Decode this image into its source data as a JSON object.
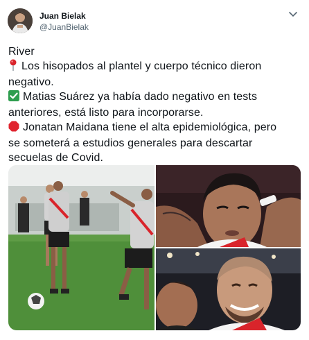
{
  "author": {
    "name": "Juan Bielak",
    "handle": "@JuanBielak"
  },
  "tweet": {
    "lines": [
      {
        "emoji": "",
        "text": "River"
      },
      {
        "emoji": "round-pushpin-icon",
        "text": "Los hisopados al plantel y cuerpo técnico dieron"
      },
      {
        "emoji": "",
        "text": "negativo."
      },
      {
        "emoji": "check-mark-button-icon",
        "text": "Matias Suárez ya había dado negativo en tests"
      },
      {
        "emoji": "",
        "text": "anteriores, está listo para incorporarse."
      },
      {
        "emoji": "stop-sign-icon",
        "text": "Jonatan Maidana tiene el alta epidemiológica, pero"
      },
      {
        "emoji": "",
        "text": "se someterá a estudios generales para descartar"
      },
      {
        "emoji": "",
        "text": "secuelas de Covid."
      }
    ]
  },
  "media": {
    "photos": [
      "training-photo",
      "matias-suarez-photo",
      "jonatan-maidana-photo"
    ]
  },
  "colors": {
    "text": "#0f1419",
    "secondary": "#536471",
    "check_green": "#2e9e4f",
    "stop_red": "#e0242f",
    "pin_red": "#d9242b"
  }
}
